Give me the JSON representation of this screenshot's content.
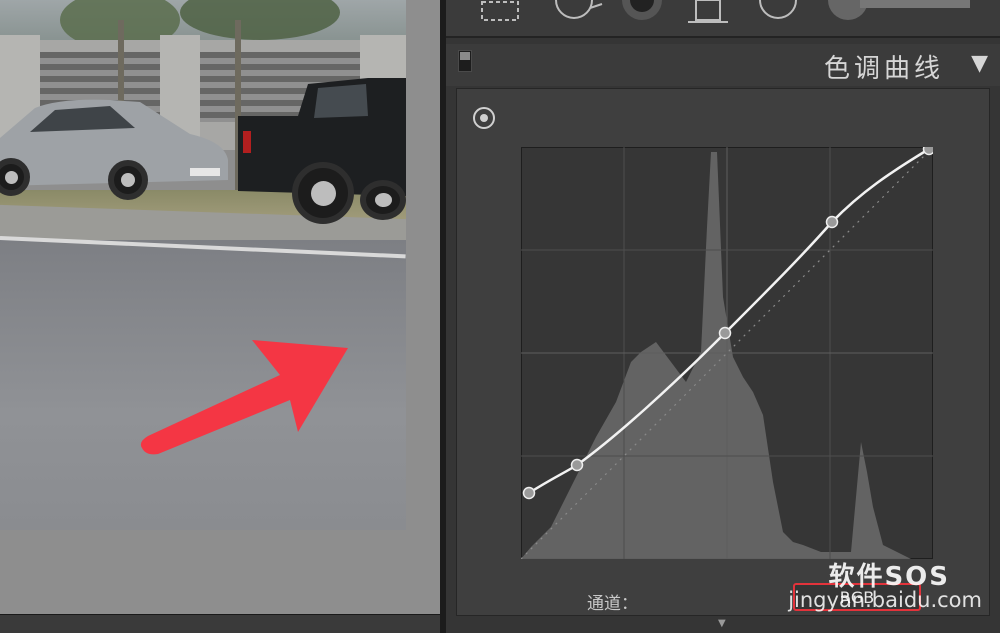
{
  "tone_curve_panel": {
    "title": "色调曲线",
    "collapse_glyph": "▼",
    "channel_label": "通道：",
    "channel_value": "RGB"
  },
  "toolbar_icons": [
    "crop-icon",
    "spot-removal-icon",
    "red-eye-icon",
    "graduated-filter-icon",
    "radial-filter-icon",
    "brush-icon"
  ],
  "watermark": {
    "logo_text": "软件SOS",
    "url_text": "jingyan.baidu.com"
  },
  "colors": {
    "accent_red": "#e3333b",
    "panel_bg": "#3f3f3f"
  }
}
